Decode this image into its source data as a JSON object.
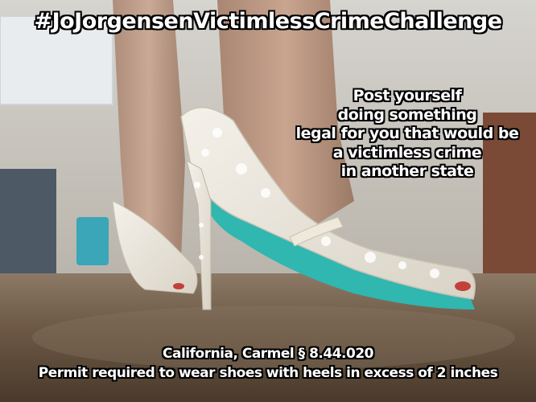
{
  "meme": {
    "top_caption": "#JoJorgensenVictimlessCrimeChallenge",
    "side_caption_lines": [
      "Post yourself",
      "doing something",
      "legal for you that would be",
      "a victimless crime",
      "in another state"
    ],
    "bottom_caption_lines": [
      "California, Carmel § 8.44.020",
      "Permit required to wear shoes with heels in excess of 2 inches"
    ]
  },
  "colors": {
    "caption_text": "#ffffff",
    "caption_outline": "#000000",
    "shoe_sole": "#2fb7b0",
    "shoe_lace": "#f3efe6"
  },
  "photo": {
    "subject": "white-lace-high-heel-shoe"
  }
}
